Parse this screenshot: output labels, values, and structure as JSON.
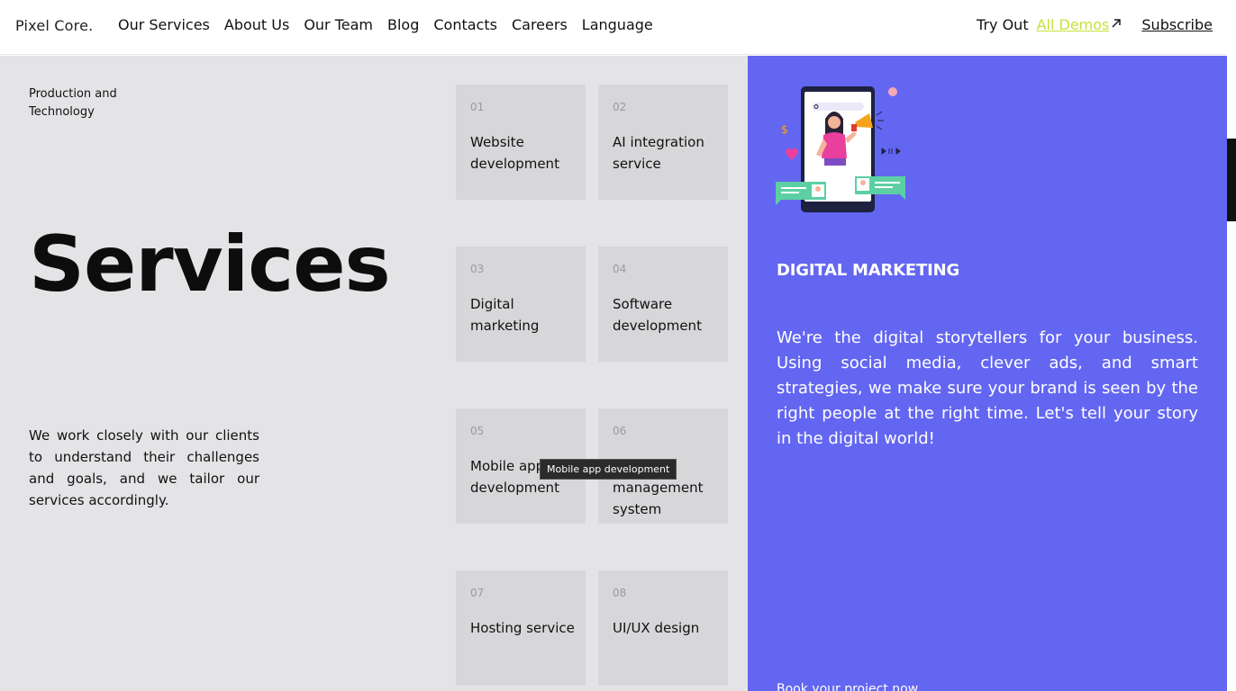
{
  "header": {
    "logo": "Pixel Core.",
    "nav": [
      "Our Services",
      "About Us",
      "Our Team",
      "Blog",
      "Contacts",
      "Careers",
      "Language"
    ],
    "try_out": "Try Out",
    "all_demos": "All Demos",
    "subscribe": "Subscribe"
  },
  "left": {
    "eyebrow": "Production and Technology",
    "title": "Services",
    "description": "We work closely with our clients to understand their challenges and goals, and we tailor our services accordingly."
  },
  "services": [
    {
      "num": "01",
      "label": "Website development"
    },
    {
      "num": "02",
      "label": "AI integration service"
    },
    {
      "num": "03",
      "label": "Digital marketing"
    },
    {
      "num": "04",
      "label": "Software development"
    },
    {
      "num": "05",
      "label": "Mobile app development"
    },
    {
      "num": "06",
      "label": "management system"
    },
    {
      "num": "07",
      "label": "Hosting service"
    },
    {
      "num": "08",
      "label": "UI/UX design"
    }
  ],
  "tooltip": "Mobile app development",
  "panel": {
    "title": "DIGITAL MARKETING",
    "text": "We're the digital storytellers for your business. Using social media, clever ads, and smart strategies, we make sure your brand is seen by the right people at the right time. Let's tell your story in the digital world!",
    "cta": "Book your project now"
  },
  "colors": {
    "accent_purple": "#6366f1",
    "demo_link": "#c4e33b",
    "card_bg": "#d7d7da",
    "page_bg": "#e4e4e7"
  },
  "icons": {
    "illustration": "phone-megaphone-illustration",
    "external": "arrow-up-right-icon"
  }
}
